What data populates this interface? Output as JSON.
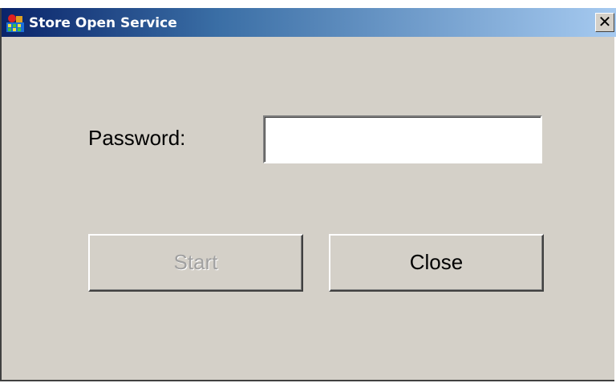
{
  "window": {
    "title": "Store Open Service",
    "close_glyph": "✕",
    "icon": "app-store-icon"
  },
  "form": {
    "password_label": "Password:",
    "password_value": "",
    "password_placeholder": ""
  },
  "buttons": {
    "start_label": "Start",
    "start_enabled": false,
    "close_label": "Close"
  },
  "colors": {
    "titlebar_start": "#0a246a",
    "titlebar_end": "#a6caf0",
    "dialog_bg": "#d4d0c8",
    "disabled_text": "#a0a0a0"
  }
}
